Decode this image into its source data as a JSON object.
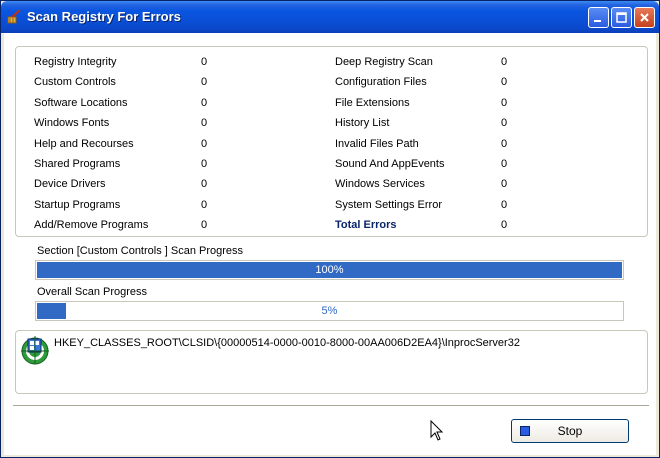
{
  "window": {
    "title": "Scan Registry For Errors"
  },
  "stats_left": [
    {
      "label": "Registry Integrity",
      "value": "0"
    },
    {
      "label": "Custom Controls",
      "value": "0"
    },
    {
      "label": "Software Locations",
      "value": "0"
    },
    {
      "label": "Windows Fonts",
      "value": "0"
    },
    {
      "label": "Help and Recourses",
      "value": "0"
    },
    {
      "label": "Shared Programs",
      "value": "0"
    },
    {
      "label": "Device Drivers",
      "value": "0"
    },
    {
      "label": "Startup Programs",
      "value": "0"
    },
    {
      "label": "Add/Remove Programs",
      "value": "0"
    }
  ],
  "stats_right": [
    {
      "label": "Deep Registry Scan",
      "value": "0"
    },
    {
      "label": "Configuration Files",
      "value": "0"
    },
    {
      "label": "File Extensions",
      "value": "0"
    },
    {
      "label": "History List",
      "value": "0"
    },
    {
      "label": "Invalid Files Path",
      "value": "0"
    },
    {
      "label": "Sound And AppEvents",
      "value": "0"
    },
    {
      "label": "Windows Services",
      "value": "0"
    },
    {
      "label": "System Settings Error",
      "value": "0"
    },
    {
      "label": "Total Errors",
      "value": "0"
    }
  ],
  "section_progress": {
    "label": "Section [Custom Controls ] Scan Progress",
    "percent": 100,
    "text": "100%"
  },
  "overall_progress": {
    "label": "Overall Scan Progress",
    "percent": 5,
    "text": "5%"
  },
  "current_path": "HKEY_CLASSES_ROOT\\CLSID\\{00000514-0000-0010-8000-00AA006D2EA4}\\InprocServer32",
  "stop_button": {
    "label": "Stop"
  },
  "colors": {
    "title_blue": "#0A56E0",
    "progress_blue": "#316AC5",
    "total_label": "#0A246A"
  }
}
